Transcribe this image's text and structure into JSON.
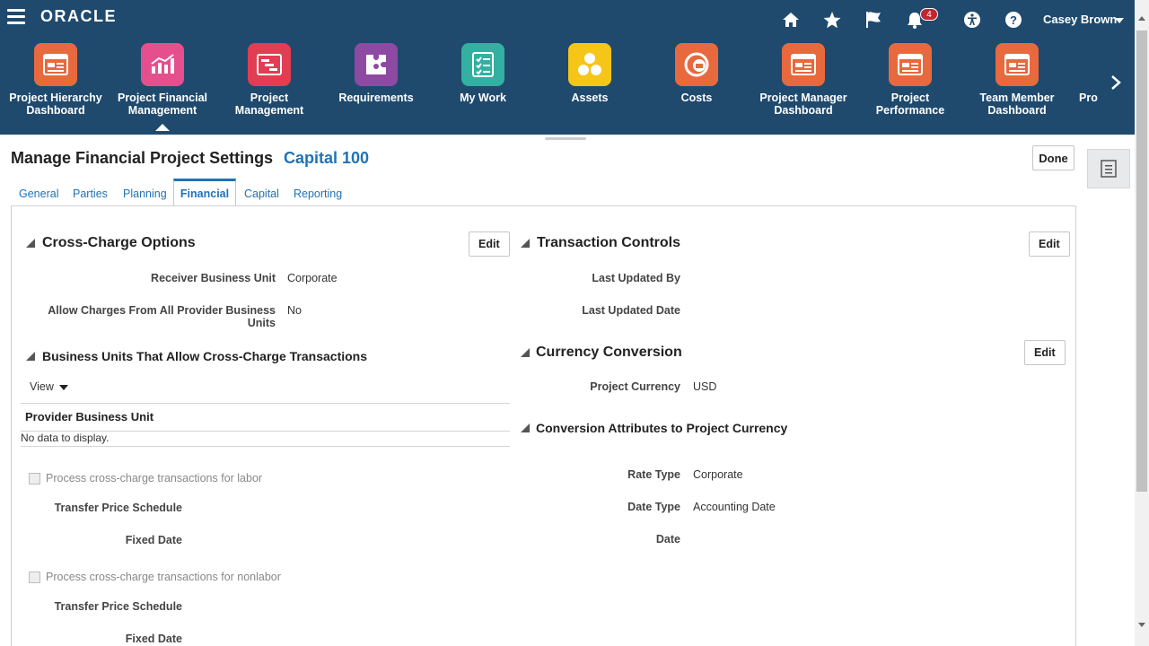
{
  "header": {
    "logo": "ORACLE",
    "notifications_count": "4",
    "user_name": "Casey Brown"
  },
  "springboard": [
    {
      "label": "Project Hierarchy Dashboard",
      "color": "#e8693e",
      "icon": "dashboard-icon"
    },
    {
      "label": "Project Financial Management",
      "color": "#e64f8d",
      "icon": "bar-chart-icon",
      "active": true
    },
    {
      "label": "Project Management",
      "color": "#e23d52",
      "icon": "gantt-icon"
    },
    {
      "label": "Requirements",
      "color": "#8e4aa3",
      "icon": "puzzle-icon"
    },
    {
      "label": "My Work",
      "color": "#33b0a2",
      "icon": "checklist-icon"
    },
    {
      "label": "Assets",
      "color": "#f5c518",
      "icon": "assets-icon"
    },
    {
      "label": "Costs",
      "color": "#e8693e",
      "icon": "costs-icon"
    },
    {
      "label": "Project Manager Dashboard",
      "color": "#e8693e",
      "icon": "dashboard-icon"
    },
    {
      "label": "Project Performance Dashboard",
      "color": "#e8693e",
      "icon": "dashboard-icon"
    },
    {
      "label": "Team Member Dashboard",
      "color": "#e8693e",
      "icon": "dashboard-icon"
    },
    {
      "label": "Pro",
      "color": "#1f4a6e",
      "icon": "dashboard-icon"
    }
  ],
  "page": {
    "title": "Manage Financial Project Settings",
    "project": "Capital 100",
    "done_label": "Done"
  },
  "tabs": [
    "General",
    "Parties",
    "Planning",
    "Financial",
    "Capital",
    "Reporting"
  ],
  "active_tab": "Financial",
  "cross_charge": {
    "title": "Cross-Charge Options",
    "edit_label": "Edit",
    "receiver_bu_label": "Receiver Business Unit",
    "receiver_bu_value": "Corporate",
    "allow_all_label": "Allow Charges From All Provider Business Units",
    "allow_all_value": "No",
    "bu_section_title": "Business Units That Allow Cross-Charge Transactions",
    "view_label": "View",
    "column_header": "Provider Business Unit",
    "no_data": "No data to display.",
    "labor_checkbox": "Process cross-charge transactions for labor",
    "nonlabor_checkbox": "Process cross-charge transactions for nonlabor",
    "transfer_price_label": "Transfer Price Schedule",
    "fixed_date_label": "Fixed Date"
  },
  "transaction_controls": {
    "title": "Transaction Controls",
    "edit_label": "Edit",
    "last_updated_by_label": "Last Updated By",
    "last_updated_date_label": "Last Updated Date"
  },
  "currency_conversion": {
    "title": "Currency Conversion",
    "edit_label": "Edit",
    "project_currency_label": "Project Currency",
    "project_currency_value": "USD",
    "attributes_title": "Conversion Attributes to Project Currency",
    "rate_type_label": "Rate Type",
    "rate_type_value": "Corporate",
    "date_type_label": "Date Type",
    "date_type_value": "Accounting Date",
    "date_label": "Date"
  }
}
